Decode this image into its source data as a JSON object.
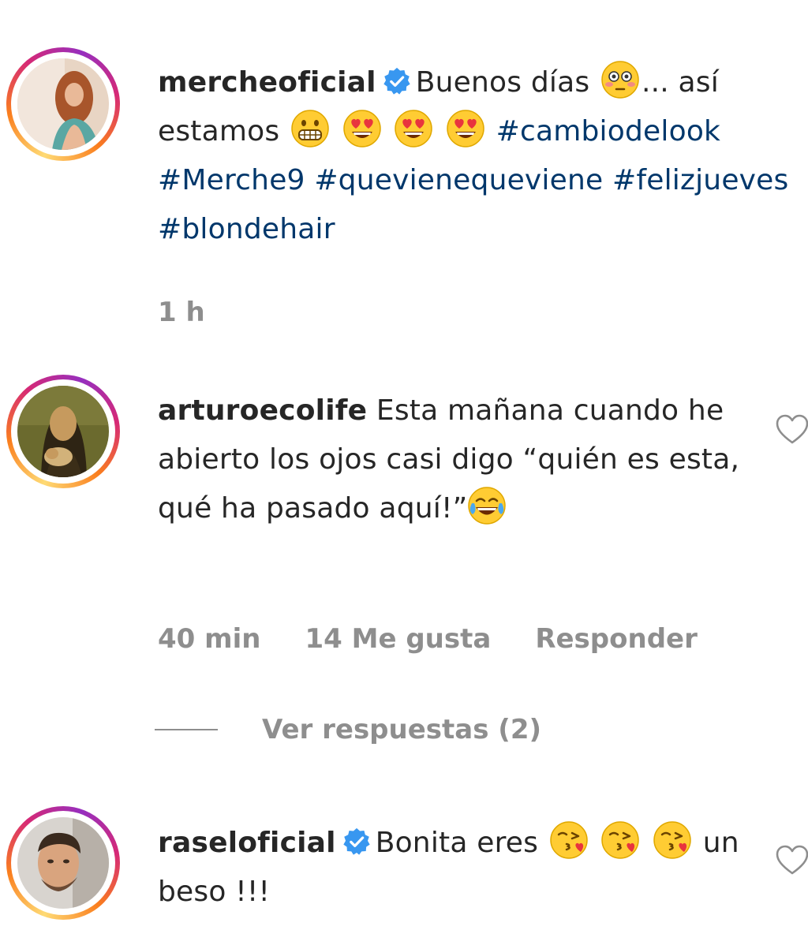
{
  "caption": {
    "username": "mercheoficial",
    "verified": true,
    "text_1": "Buenos días",
    "text_2": "... así estamos",
    "hashtags": [
      "#cambiodelook",
      "#Merche9",
      "#quevienequeviene",
      "#felizjueves",
      "#blondehair"
    ],
    "time": "1 h",
    "emojis": [
      "flushed-face-emoji",
      "grimacing-face-emoji",
      "heart-eyes-emoji",
      "heart-eyes-emoji",
      "heart-eyes-emoji"
    ]
  },
  "comments": [
    {
      "username": "arturoecolife",
      "verified": false,
      "text": "Esta mañana cuando he abierto los ojos casi digo “quién es esta, qué ha pasado aquí!”",
      "emojis": [
        "tears-of-joy-emoji"
      ],
      "time": "40 min",
      "likes": "14 Me gusta",
      "reply": "Responder",
      "view_replies": "Ver respuestas (2)"
    },
    {
      "username": "raseloficial",
      "verified": true,
      "text_1": "Bonita eres",
      "text_2": "un beso !!!",
      "emojis": [
        "kissing-heart-emoji",
        "kissing-heart-emoji",
        "kissing-heart-emoji"
      ]
    }
  ],
  "colors": {
    "text": "#262626",
    "secondary": "#8e8e8e",
    "hashtag": "#00376b",
    "verified": "#3897f0"
  }
}
